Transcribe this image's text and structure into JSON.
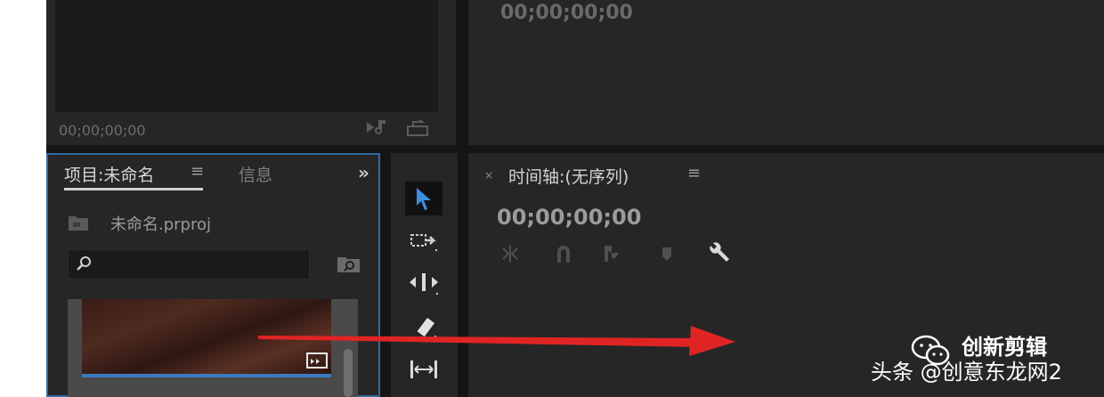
{
  "source_monitor": {
    "timecode": "00;00;00;00",
    "icons": [
      "audio-export-icon",
      "export-frame-icon"
    ]
  },
  "program_monitor": {
    "timecode": "00;00;00;00"
  },
  "project_panel": {
    "tab_project": "项目:未命名",
    "tab_menu": "≡",
    "tab_info": "信息",
    "more": "»",
    "file_name": "未命名.prproj",
    "search_value": "",
    "accent": "#2f6ba4"
  },
  "tools": [
    "selection-tool",
    "track-select-tool",
    "ripple-edit-tool",
    "razor-tool",
    "slip-tool"
  ],
  "timeline": {
    "title": "时间轴:(无序列)",
    "menu": "≡",
    "close": "×",
    "timecode": "00;00;00;00",
    "icons": [
      "nest-icon",
      "snap-icon",
      "linked-selection-icon",
      "add-marker-icon",
      "settings-wrench-icon"
    ]
  },
  "annotation": {
    "arrow_color": "#e02424"
  },
  "watermark": {
    "brand": "创新剪辑",
    "line": "头条 @创意东龙网2"
  }
}
